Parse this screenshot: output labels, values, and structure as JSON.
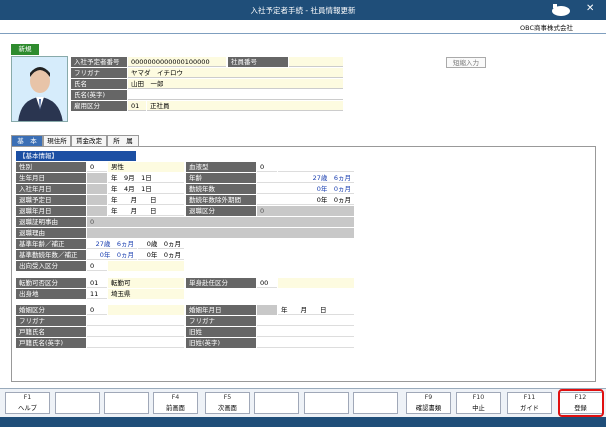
{
  "window": {
    "title": "入社予定者手続 - 社員情報更新"
  },
  "company": "OBC商事株式会社",
  "new_tag": "新規",
  "header": {
    "planned_no_label": "入社予定者番号",
    "planned_no": "0000000000000100000",
    "emp_no_label": "社員番号",
    "emp_no": "",
    "furigana_label": "フリガナ",
    "furigana": "ヤマダ　イチロウ",
    "name_label": "氏名",
    "name": "山田　一郎",
    "name_en_label": "氏名(英字)",
    "name_en": "",
    "employ_label": "雇用区分",
    "employ_code": "01",
    "employ_name": "正社員"
  },
  "kana_button": "短縮入力",
  "tabs": [
    "基　本",
    "現住所",
    "賃金改定",
    "所　属"
  ],
  "section_title": "【基本情報】",
  "basic": {
    "gender_label": "性別",
    "gender_code": "0",
    "gender": "男性",
    "blood_label": "血液型",
    "blood_code": "0",
    "birth_label": "生年月日",
    "birth_y": "年",
    "birth_m": "9月",
    "birth_d": "1日",
    "age_label": "年齢",
    "age": "27歳　6ヵ月",
    "join_label": "入社年月日",
    "join_y": "年",
    "join_m": "4月",
    "join_d": "1日",
    "tenure_label": "勤続年数",
    "tenure": "0年　0ヵ月",
    "retire_plan_label": "退職予定日",
    "retire_plan_y": "年",
    "retire_plan_m": "月",
    "retire_plan_d": "日",
    "tenure_ex_label": "勤続年数除外期間",
    "tenure_ex": "0年　0ヵ月",
    "retire_label": "退職年月日",
    "retire_y": "年",
    "retire_m": "月",
    "retire_d": "日",
    "retire_kind_label": "退職区分",
    "retire_kind_code": "0",
    "retire_cert_label": "退職証明事由",
    "retire_cert_code": "0",
    "retire_reason_label": "退職理由",
    "base_age_label": "基準年齢／補正",
    "base_age": "27歳　6ヵ月",
    "base_age_adj": "0歳　0ヵ月",
    "base_tenure_label": "基準勤続年数／補正",
    "base_tenure": "0年　0ヵ月",
    "base_tenure_adj": "0年　0ヵ月",
    "secondment_label": "出向受入区分",
    "secondment_code": "0",
    "transfer_label": "転勤可否区分",
    "transfer_code": "01",
    "transfer": "転勤可",
    "single_label": "単身赴任区分",
    "single_code": "00",
    "origin_label": "出身地",
    "origin_code": "11",
    "origin": "埼玉県",
    "marriage_label": "婚姻区分",
    "marriage_code": "0",
    "marriage_date_label": "婚姻年月日",
    "marriage_date": "年　　月　　日",
    "h_furigana_label": "フリガナ",
    "old_furigana_label": "フリガナ",
    "h_name_label": "戸籍氏名",
    "old_name_label": "旧姓",
    "h_name_en_label": "戸籍氏名(英字)",
    "old_name_en_label": "旧姓(英字)"
  },
  "fkeys": [
    {
      "key": "F1",
      "label": "ヘルプ"
    },
    {
      "key": "",
      "label": ""
    },
    {
      "key": "",
      "label": ""
    },
    {
      "key": "F4",
      "label": "前画面"
    },
    {
      "key": "F5",
      "label": "次画面"
    },
    {
      "key": "",
      "label": ""
    },
    {
      "key": "",
      "label": ""
    },
    {
      "key": "",
      "label": ""
    },
    {
      "key": "F9",
      "label": "確認書類"
    },
    {
      "key": "F10",
      "label": "中止"
    },
    {
      "key": "F11",
      "label": "ガイド"
    },
    {
      "key": "F12",
      "label": "登録"
    }
  ],
  "colors": {
    "titlebar": "#1f4e79",
    "label_bg": "#666666",
    "section": "#1c4fa3",
    "highlight": "#e01010"
  }
}
